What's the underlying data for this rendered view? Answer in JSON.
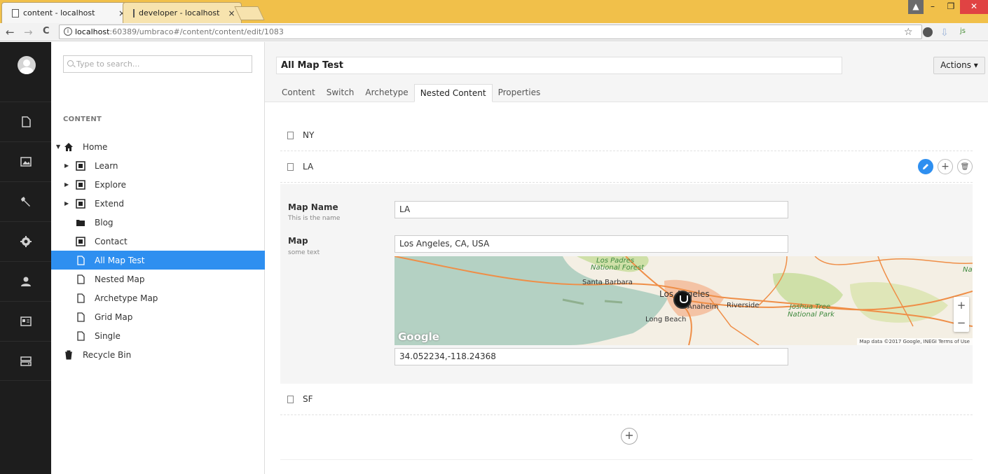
{
  "browser": {
    "tabs": [
      {
        "title": "content - localhost",
        "close": "×"
      },
      {
        "title": "developer - localhost",
        "close": "×"
      }
    ],
    "url_host": "localhost",
    "url_path": ":60389/umbraco#/content/content/edit/1083",
    "info": "i",
    "back": "←",
    "forward": "→",
    "reload": "C",
    "star": "☆",
    "ext_js": "js",
    "win": {
      "user": "▲",
      "min": "–",
      "max": "❐",
      "close": "✕"
    }
  },
  "tree": {
    "search_placeholder": "Type to search...",
    "heading": "CONTENT",
    "nodes": [
      {
        "label": "Home",
        "caret": "▼"
      },
      {
        "label": "Learn",
        "caret": "▶"
      },
      {
        "label": "Explore",
        "caret": "▶"
      },
      {
        "label": "Extend",
        "caret": "▶"
      },
      {
        "label": "Blog"
      },
      {
        "label": "Contact"
      },
      {
        "label": "All Map Test"
      },
      {
        "label": "Nested Map"
      },
      {
        "label": "Archetype Map"
      },
      {
        "label": "Grid Map"
      },
      {
        "label": "Single"
      },
      {
        "label": "Recycle Bin"
      }
    ]
  },
  "editor": {
    "name": "All Map Test",
    "actions_label": "Actions ▾",
    "tabs": [
      "Content",
      "Switch",
      "Archetype",
      "Nested Content",
      "Properties"
    ],
    "items": [
      "NY",
      "LA",
      "SF"
    ],
    "item_buttons": {
      "add": "+",
      "delete": "🗑"
    },
    "add_button": "+",
    "panel": {
      "map_name_label": "Map Name",
      "map_name_desc": "This is the name",
      "map_name_value": "LA",
      "map_label": "Map",
      "map_desc": "some text",
      "address_value": "Los Angeles, CA, USA",
      "coords_value": "34.052234,-118.24368"
    },
    "map": {
      "labels": {
        "los_padres_1": "Los Padres",
        "los_padres_2": "National Forest",
        "santa_barbara": "Santa Barbara",
        "los_angeles": "Los Angeles",
        "anaheim": "Anaheim",
        "riverside": "Riverside",
        "long_beach": "Long Beach",
        "joshua_1": "Joshua Tree",
        "joshua_2": "National Park",
        "na": "Na",
        "google": "Google",
        "attribution": "Map data ©2017 Google, INEGI   Terms of Use",
        "zoom_in": "+",
        "zoom_out": "−"
      },
      "colors": {
        "water": "#b4d1c3",
        "land": "#f4efe4",
        "green": "#cfe0a8",
        "road": "#ef8e47",
        "city": "#f3b18a"
      }
    }
  }
}
